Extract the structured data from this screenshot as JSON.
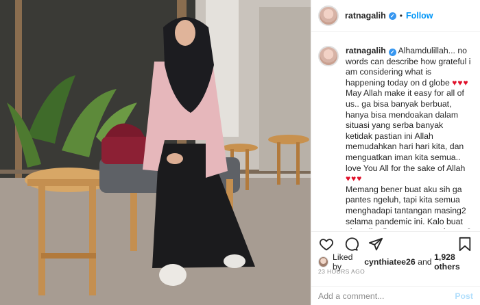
{
  "post": {
    "username": "ratnagalih",
    "follow_label": "Follow",
    "separator": "•"
  },
  "caption": {
    "username": "ratnagalih",
    "p1": "Alhamdulillah... no words can describe how grateful i am considering what is happening today on d globe",
    "p1_hearts": "♥♥♥",
    "p2": "May Allah make it easy for all of us.. ga bisa banyak berbuat, hanya bisa mendoakan dalam situasi yang serba banyak ketidak pastian ini Allah memudahkan hari hari kita, dan menguatkan iman kita semua.. love You All for the sake of Allah",
    "p2_hearts": "♥♥♥",
    "p3": "Memang bener buat aku sih ga pantes ngeluh, tapi kita semua menghadapi tantangan masing2 selama pandemic ini. Kalo buat aku pribadi memang ga ada apa2 nya mungkin sama yg temen2 smua rasakan, but trust me aku pun harus beradaptasi banyak.. mulai dari waktu tidur yg jadi super"
  },
  "likes": {
    "prefix": "Liked by",
    "user": "cynthiatee26",
    "connector": "and",
    "others": "1,928 others"
  },
  "timestamp": "23 HOURS AGO",
  "comment": {
    "placeholder": "Add a comment...",
    "post_label": "Post"
  },
  "colors": {
    "accent": "#0095f6",
    "verified": "#3897f0",
    "heart": "#e0102a",
    "post_disabled": "#b2dffc"
  },
  "icons": [
    "heart-icon",
    "comment-icon",
    "share-icon",
    "bookmark-icon",
    "verified-icon"
  ]
}
